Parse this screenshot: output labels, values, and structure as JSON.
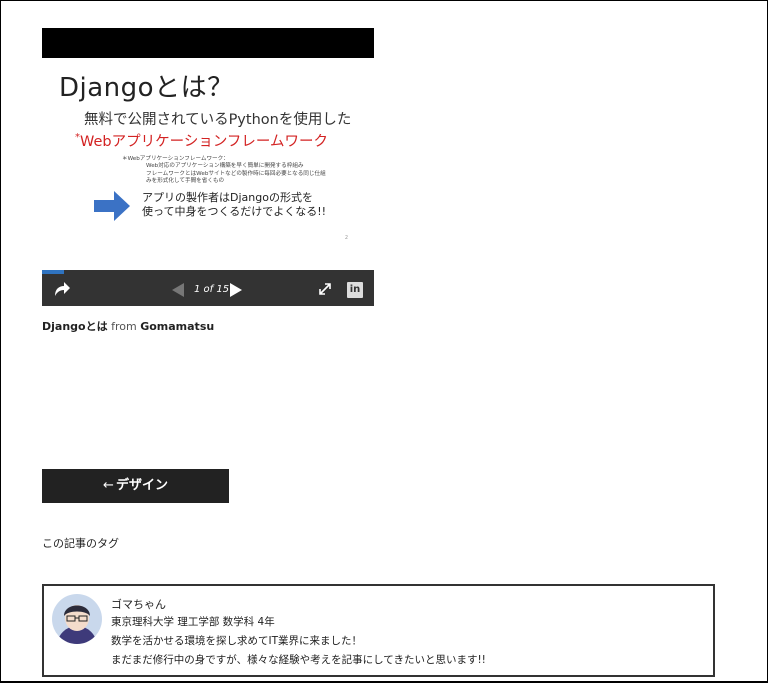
{
  "slide": {
    "title": "Djangoとは？",
    "subtitle_line1": "無料で公開されているPythonを使用した",
    "subtitle_mark": "*",
    "subtitle_line2": "Webアプリケーションフレームワーク",
    "note_line1": "＊Webアプリケーションフレームワーク：",
    "note_line2": "Web対応のアプリケーション構築を早く簡単に開発する枠組み",
    "note_line3": "フレームワークとはWebサイトなどの製作時に毎回必要となる同じ仕組",
    "note_line4": "みを形式化して手間を省くもの",
    "message_line1": "アプリの製作者はDjangoの形式を",
    "message_line2": "使って中身をつくるだけでよくなる!!",
    "page_mark": "2"
  },
  "player": {
    "page_indicator": "1 of 15",
    "progress_fraction": 0.066,
    "share_icon": "share-icon",
    "prev_icon": "prev-icon",
    "next_icon": "next-icon",
    "fullscreen_icon": "fullscreen-icon",
    "linkedin_label": "in"
  },
  "caption": {
    "title": "Djangoとは",
    "from": "from",
    "author": "Gomamatsu"
  },
  "nav": {
    "arrow": "←",
    "label": "デザイン"
  },
  "tags": {
    "label": "この記事のタグ"
  },
  "author_box": {
    "name": "ゴマちゃん",
    "affiliation": "東京理科大学 理工学部 数学科 4年",
    "bio_line1": "数学を活かせる環境を探し求めてIT業界に来ました！",
    "bio_line2": "まだまだ修行中の身ですが、様々な経験や考えを記事にしてきたいと思います!!"
  },
  "colors": {
    "accent_red": "#d32323",
    "progress_blue": "#2f73c0",
    "arrow_blue": "#3b72c5",
    "button_dark": "#222222"
  }
}
